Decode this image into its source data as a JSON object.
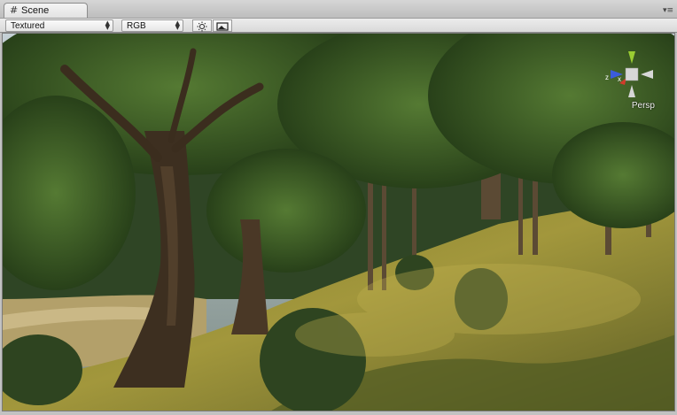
{
  "window": {
    "tab_title": "Scene",
    "tab_icon": "scene-grid-icon",
    "menu_icon": "panel-menu-icon"
  },
  "toolbar": {
    "draw_mode": "Textured",
    "render_mode": "RGB",
    "lighting_icon": "sun-icon",
    "game_overlay_icon": "image-icon"
  },
  "gizmo": {
    "projection": "Persp",
    "axis_z": "z",
    "axis_x": "x",
    "colors": {
      "y": "#9acd32",
      "z": "#3b5cdb",
      "x": "#d23b2b",
      "cube": "#d7d7d7"
    }
  },
  "scene": {
    "colors": {
      "sky": "#b9c6cf",
      "grass_light": "#a89a3a",
      "grass_dark": "#4a5420",
      "canopy": "#2d4a1c",
      "trunk": "#4a3a28"
    }
  }
}
